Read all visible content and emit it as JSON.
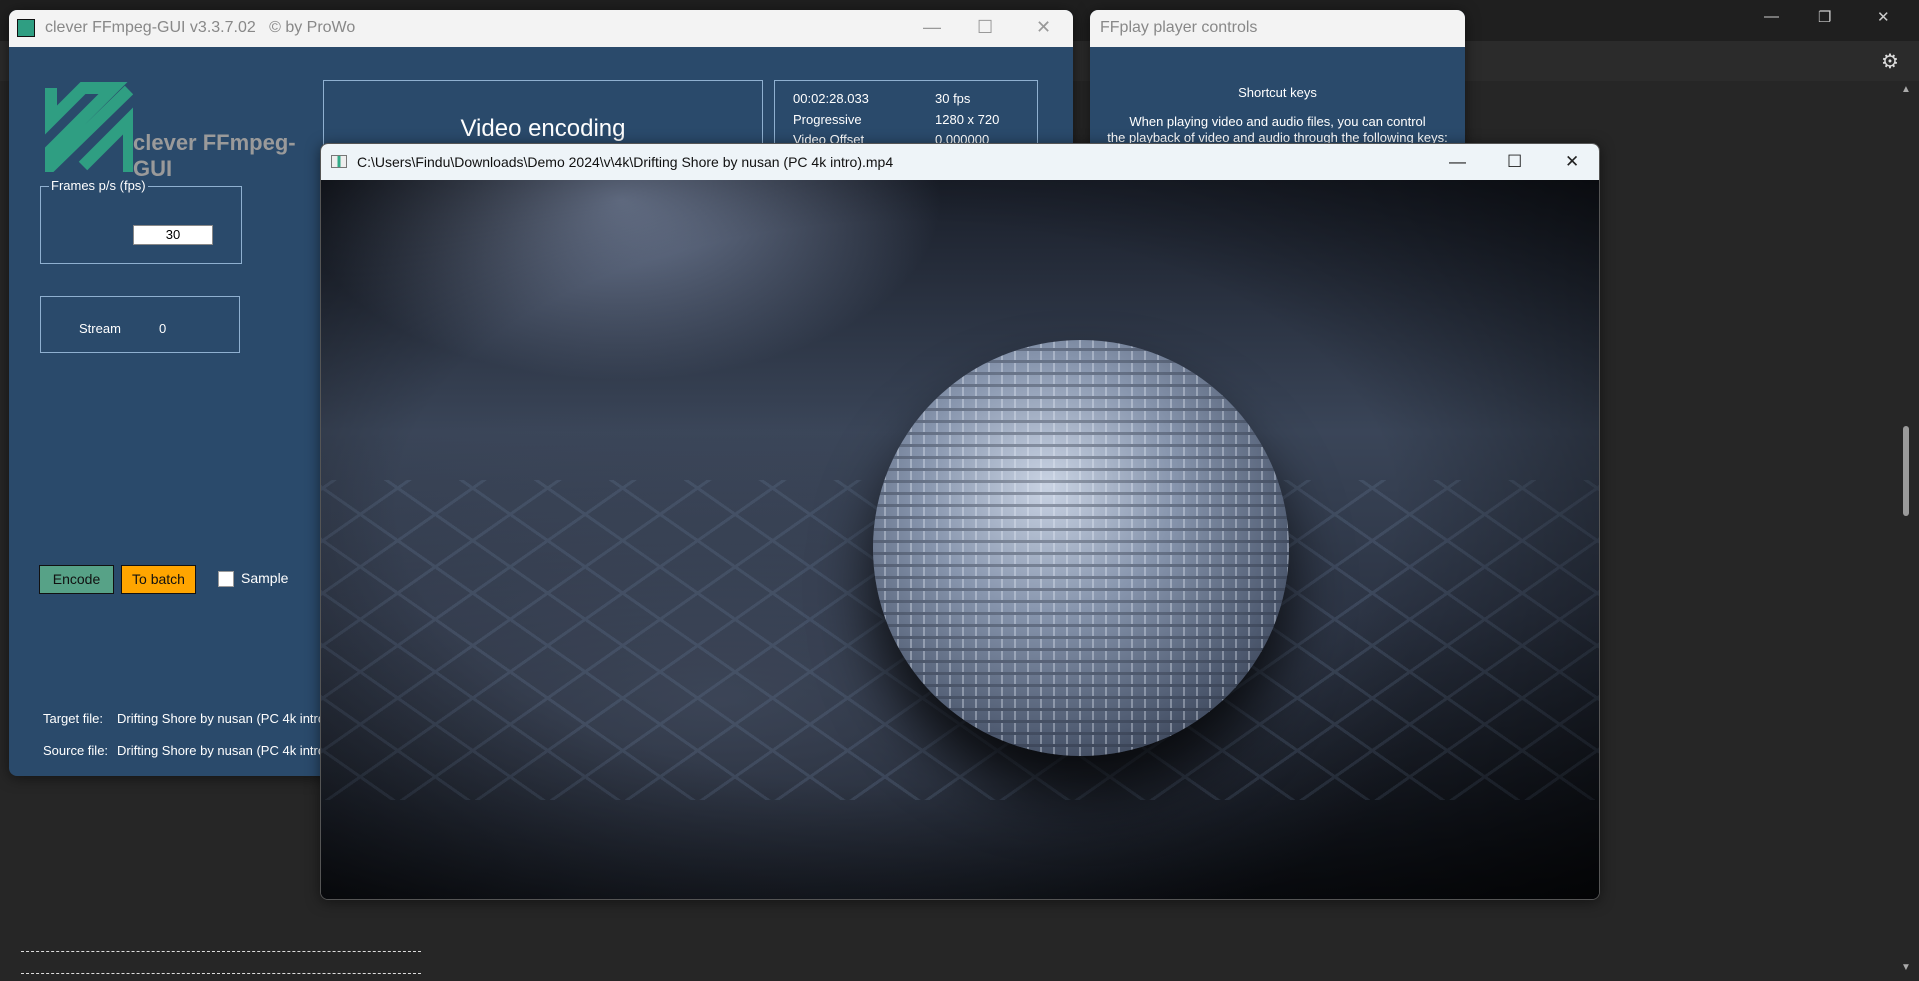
{
  "background_app": {
    "minimize_icon": "minimize-icon",
    "restore_icon": "restore-icon",
    "close_icon": "close-icon",
    "settings_icon": "gear-icon",
    "dash_line": "- - - - - - - - - - - - - - - - - - - - - - - - - - - - - - - - - - - - - - - - - -"
  },
  "main_window": {
    "title": "clever FFmpeg-GUI v3.3.7.02   © by ProWo",
    "logo_text": "clever FFmpeg-GUI",
    "mode_title": "Video encoding",
    "info": [
      {
        "label": "00:02:28.033",
        "value": "30 fps"
      },
      {
        "label": "Progressive",
        "value": "1280 x 720"
      },
      {
        "label": "Video Offset",
        "value": "0.000000"
      }
    ],
    "fps_legend": "Frames p/s (fps)",
    "fps_value": "30",
    "stream_label": "Stream",
    "stream_value": "0",
    "encode_label": "Encode",
    "batch_label": "To batch",
    "sample_label": "Sample",
    "sample_checked": false,
    "target_label": "Target file:",
    "target_value": "Drifting Shore by nusan (PC 4k intro",
    "source_label": "Source file:",
    "source_value": "Drifting Shore by nusan (PC 4k intro",
    "colors": {
      "panel": "#2a4a6b",
      "encode": "#57a287",
      "batch": "#ffa500",
      "logo": "#2f9e82"
    }
  },
  "ffplay_controls": {
    "title": "FFplay player controls",
    "heading": "Shortcut keys",
    "line1": "When playing video and audio files, you can control",
    "line2": "the playback of video and audio through the following keys:"
  },
  "video_window": {
    "title": "C:\\Users\\Findu\\Downloads\\Demo 2024\\v\\4k\\Drifting Shore by nusan (PC 4k intro).mp4"
  }
}
